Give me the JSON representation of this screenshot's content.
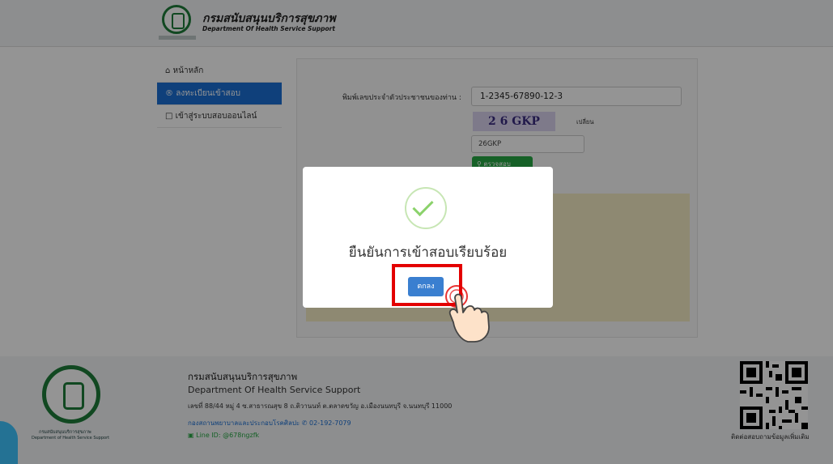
{
  "header": {
    "title_th": "กรมสนับสนุนบริการสุขภาพ",
    "title_en": "Department Of Health Service Support"
  },
  "menu": [
    {
      "icon": "home-icon",
      "label": "หน้าหลัก",
      "active": false
    },
    {
      "icon": "registered-icon",
      "label": "ลงทะเบียนเข้าสอบ",
      "active": true
    },
    {
      "icon": "monitor-icon",
      "label": "เข้าสู่ระบบสอบออนไลน์",
      "active": false
    }
  ],
  "form": {
    "id_label": "พิมพ์เลขประจำตัวประชาชนของท่าน :",
    "id_value": "1-2345-67890-12-3",
    "captcha_text": "2 6 GKP",
    "change_label": "เปลี่ยน",
    "captcha_input": "26GKP",
    "check_button": "ตรวจสอบ"
  },
  "modal": {
    "title": "ยืนยันการเข้าสอบเรียบร้อย",
    "ok_button": "ตกลง"
  },
  "footer": {
    "name_th": "กรมสนับสนุนบริการสุขภาพ",
    "name_en": "Department Of Health Service Support",
    "address": "เลขที่ 88/44 หมู่ 4 ซ.สาธารณสุข 8 ถ.ติวานนท์ ต.ตลาดขวัญ อ.เมืองนนทบุรี จ.นนทบุรี 11000",
    "link": "กองสถานพยาบาลและประกอบโรคศิลปะ",
    "phone": "02-192-7079",
    "line": "Line ID: @678ngzfk",
    "qr_label": "ติดต่อสอบถามข้อมูลเพิ่มเติม",
    "logo_th": "กรมสนับสนุนบริการสุขภาพ",
    "logo_en": "Department of Health Service Support"
  },
  "colors": {
    "primary": "#1a6fd4",
    "success": "#27a844",
    "highlight": "#e30000"
  }
}
